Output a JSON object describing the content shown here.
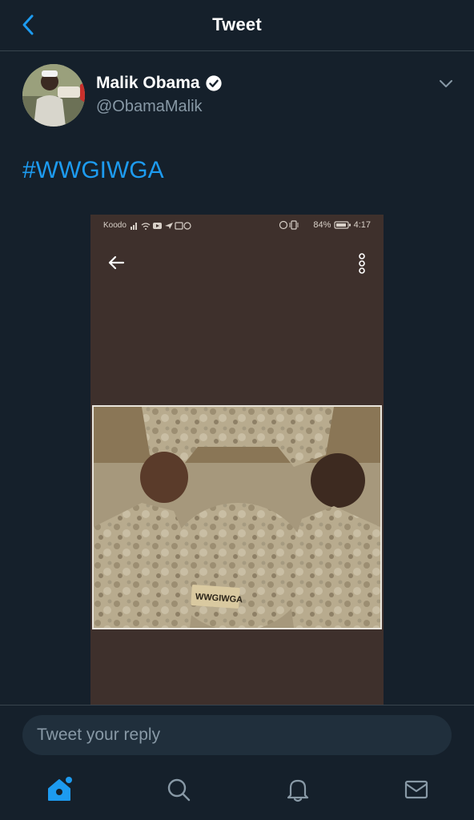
{
  "nav": {
    "title": "Tweet",
    "back_icon": "chevron-left-icon"
  },
  "author": {
    "name": "Malik Obama",
    "handle": "@ObamaMalik",
    "verified_icon": "verified-badge-icon",
    "menu_icon": "chevron-down-icon"
  },
  "tweet": {
    "text": "#WWGIWGA"
  },
  "media": {
    "status_bar": {
      "carrier": "Koodo",
      "battery": "84%",
      "time": "4:17"
    },
    "back_icon": "arrow-left-icon",
    "menu_icon": "more-vertical-icon",
    "helmet_label": "WWGIWGA",
    "background_color": "#3e302c"
  },
  "reply": {
    "placeholder": "Tweet your reply"
  },
  "tabbar": {
    "items": [
      {
        "icon": "home-icon",
        "active": true
      },
      {
        "icon": "search-icon",
        "active": false
      },
      {
        "icon": "bell-icon",
        "active": false
      },
      {
        "icon": "mail-icon",
        "active": false
      }
    ]
  },
  "colors": {
    "background": "#15202b",
    "accent": "#1d9bf0",
    "muted": "#8899a6"
  }
}
